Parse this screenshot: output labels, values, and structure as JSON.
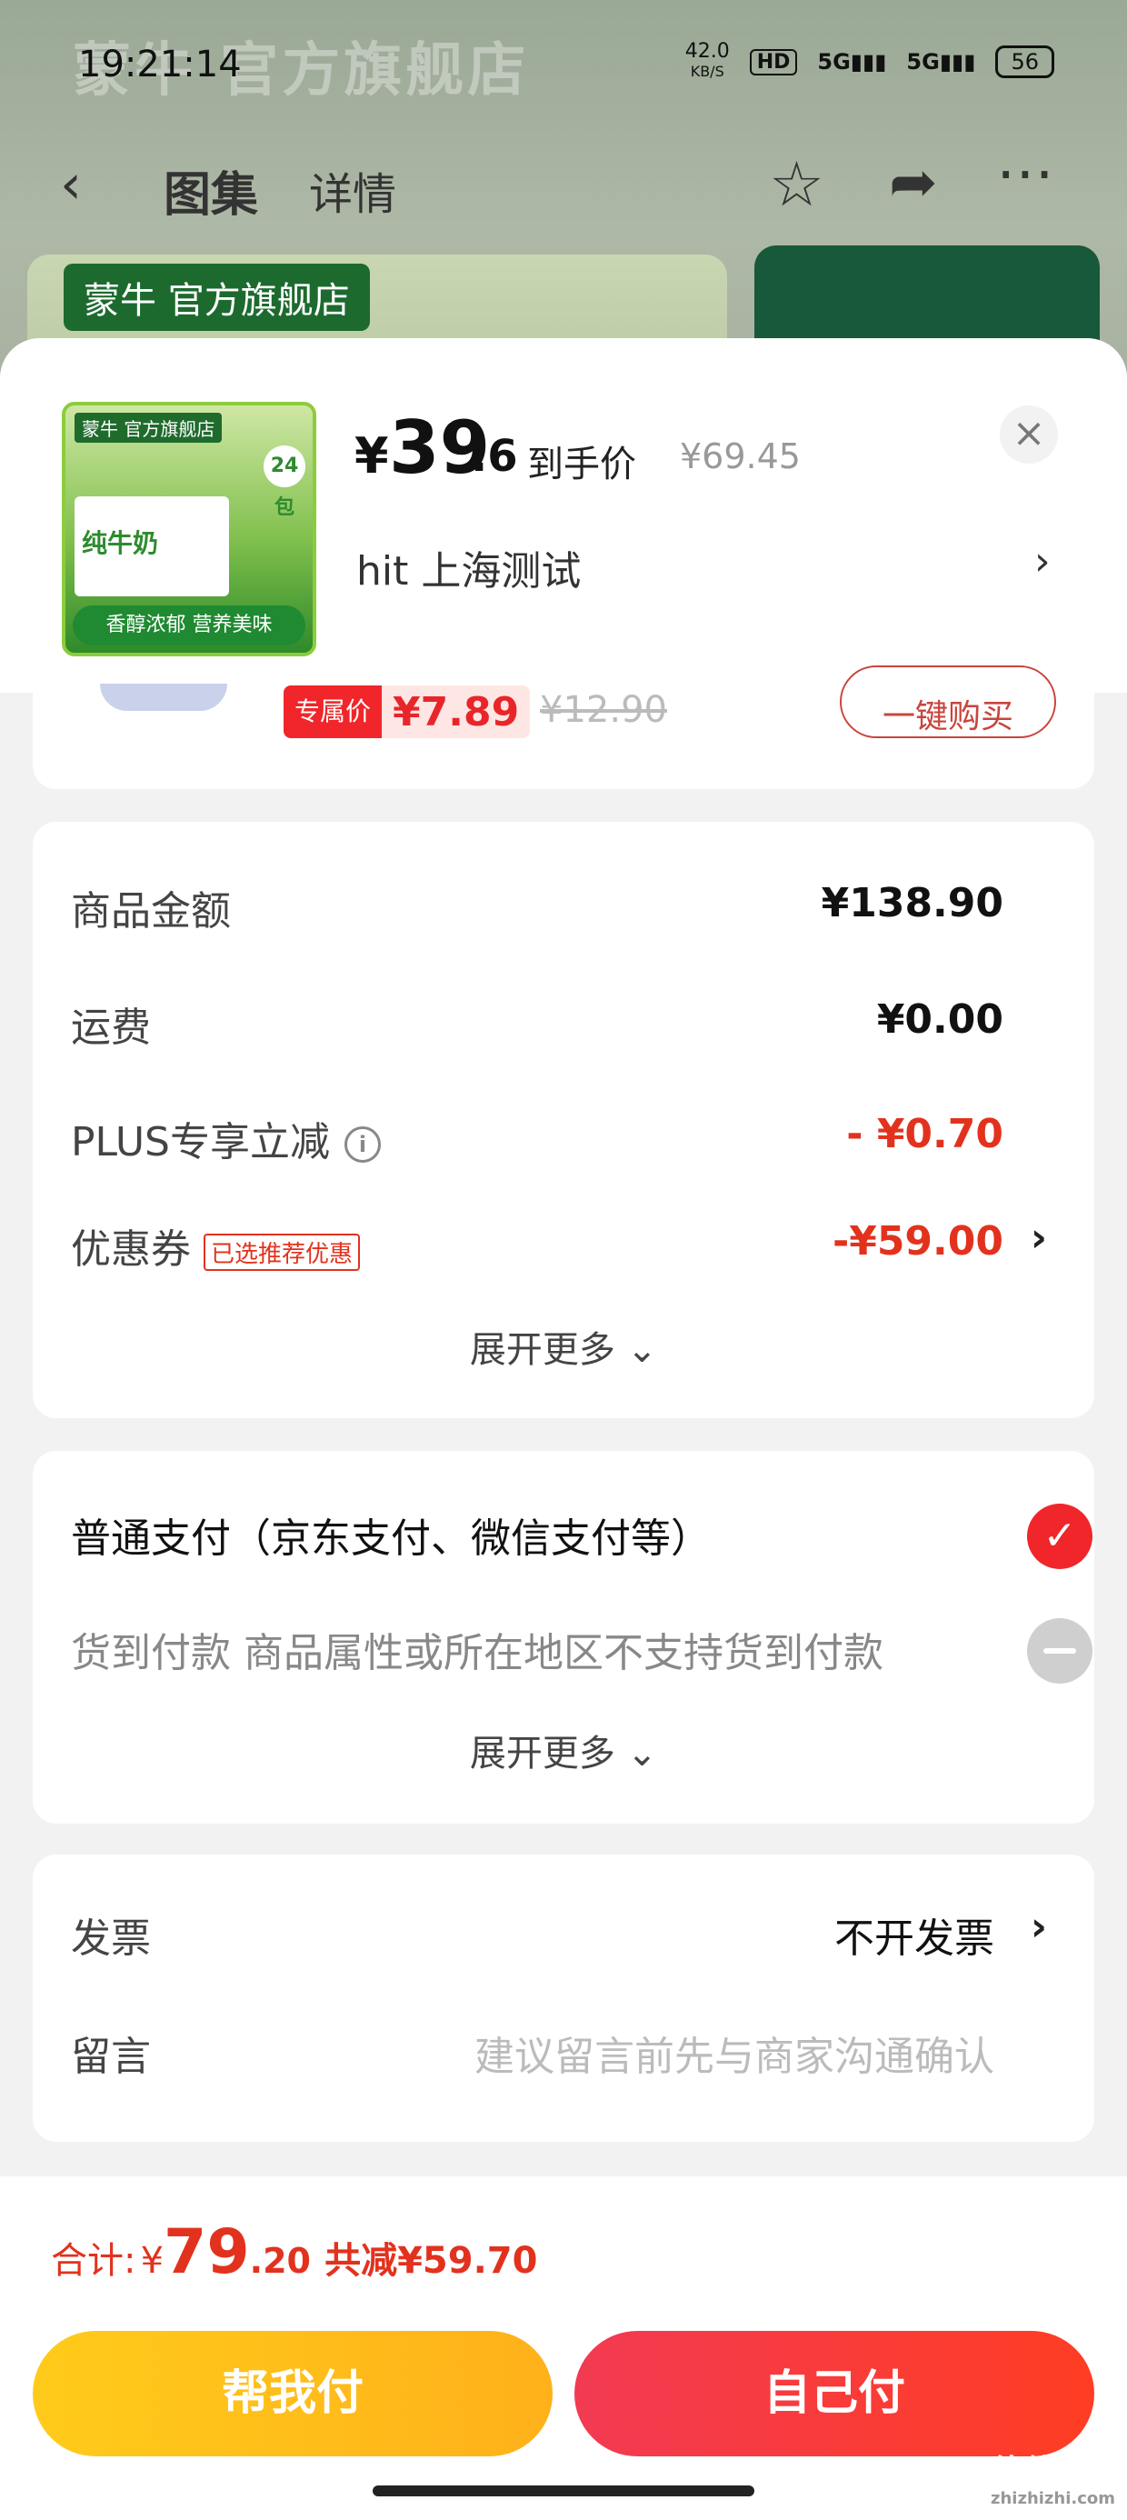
{
  "status_bar": {
    "time": "19:21:14",
    "net_speed": "42.0",
    "net_unit": "KB/S",
    "hd": "HD",
    "sig1": "5G",
    "sig2": "5G",
    "battery": "56"
  },
  "background": {
    "banner_text": "蒙牛 官方旗舰店",
    "logo_text": "蒙牛 官方旗舰店"
  },
  "nav": {
    "back_icon": "‹",
    "tab_gallery": "图集",
    "tab_detail": "详情"
  },
  "product_header": {
    "thumb_brand": "蒙牛 官方旗舰店",
    "thumb_product": "纯牛奶",
    "thumb_badge": "24包",
    "thumb_tag": "香醇浓郁 营养美味",
    "currency": "¥",
    "price_int": "39",
    "price_dec": ".6",
    "price_label": "到手价",
    "price_original": "¥69.45",
    "address": "hit  上海测试"
  },
  "partial_item": {
    "exclusive_label": "专属价",
    "exclusive_price": "¥7.89",
    "original_price": "¥12.90",
    "buy_label": "一键购买"
  },
  "summary": {
    "rows": [
      {
        "label": "商品金额",
        "value": "¥138.90"
      },
      {
        "label": "运费",
        "value": "¥0.00"
      },
      {
        "label": "PLUS专享立减",
        "value": "- ¥0.70"
      },
      {
        "label": "优惠券",
        "value": "-¥59.00",
        "tag": "已选推荐优惠"
      }
    ],
    "expand": "展开更多"
  },
  "payment": {
    "option1": "普通支付（京东支付、微信支付等）",
    "option2": "货到付款 商品属性或所在地区不支持货到付款",
    "expand": "展开更多"
  },
  "extras": {
    "invoice_label": "发票",
    "invoice_value": "不开发票",
    "message_label": "留言",
    "message_placeholder": "建议留言前先与商家沟通确认"
  },
  "footer": {
    "total_label": "合计:",
    "total_currency": "¥",
    "total_int": "79",
    "total_dec": ".20",
    "total_saved": "共减¥59.70",
    "help_pay": "帮我付",
    "self_pay": "自己付"
  },
  "watermark": {
    "text": "值值值",
    "sub": "zhizhizhi.com"
  },
  "colors": {
    "accent_red": "#e2321e",
    "help_btn": "#ffb11a",
    "self_btn": "#f23a52"
  }
}
